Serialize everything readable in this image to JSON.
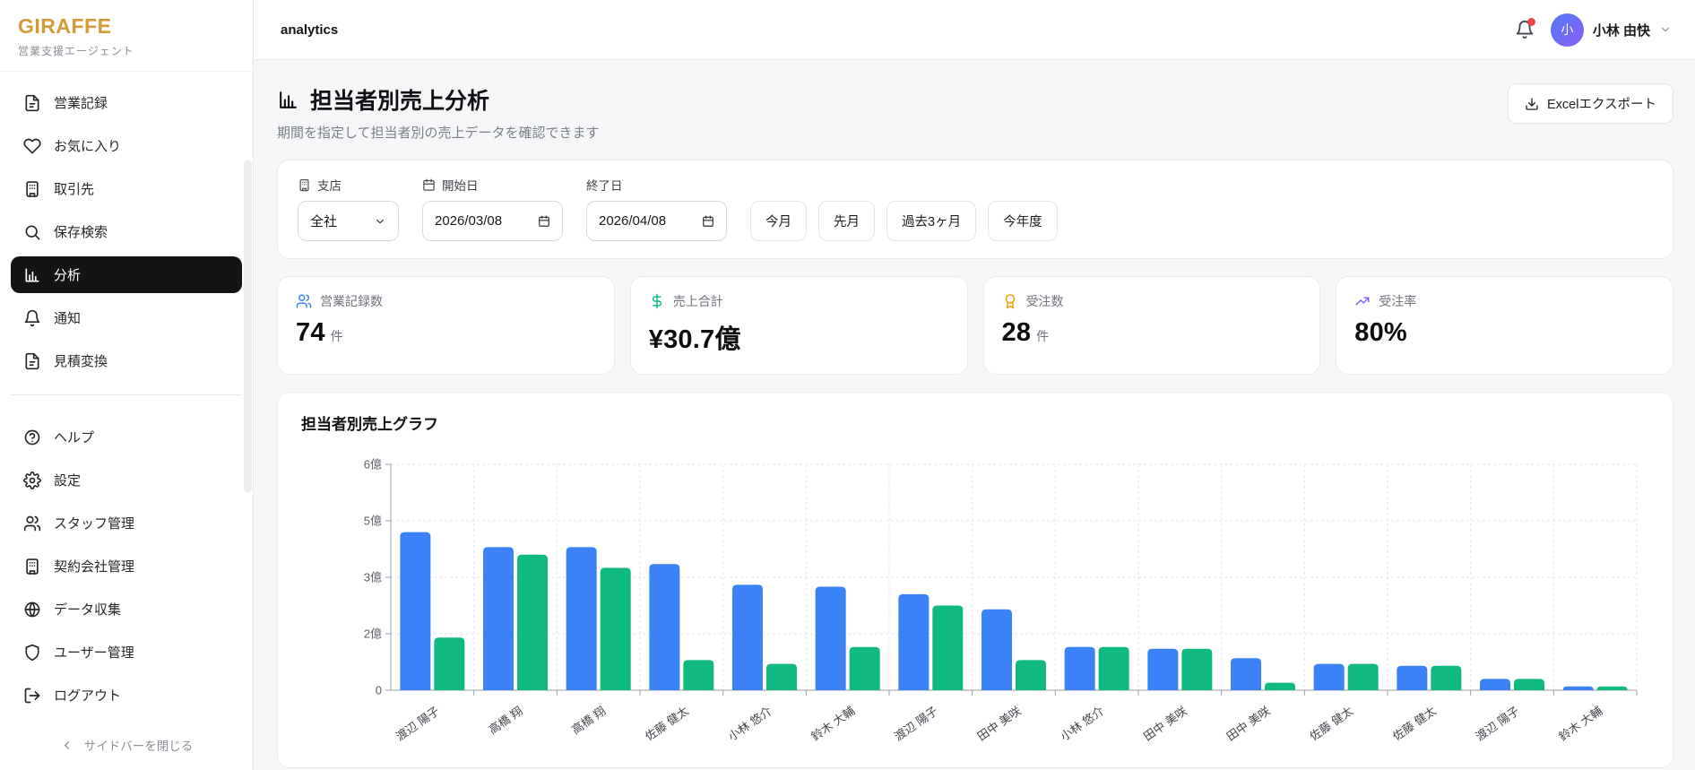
{
  "brand": {
    "name": "GIRAFFE",
    "tagline": "営業支援エージェント",
    "color": "#d49a35"
  },
  "topbar": {
    "title": "analytics",
    "user_name": "小林 由快",
    "avatar_initial": "小",
    "avatar_gradient": [
      "#4f7cf7",
      "#8b5cf6"
    ],
    "notification_dot_color": "#ef4444"
  },
  "sidebar": {
    "main_items": [
      {
        "label": "営業記録",
        "icon": "file-text",
        "active": false
      },
      {
        "label": "お気に入り",
        "icon": "heart",
        "active": false
      },
      {
        "label": "取引先",
        "icon": "building",
        "active": false
      },
      {
        "label": "保存検索",
        "icon": "search",
        "active": false
      },
      {
        "label": "分析",
        "icon": "bar-chart",
        "active": true
      },
      {
        "label": "通知",
        "icon": "bell",
        "active": false
      },
      {
        "label": "見積変換",
        "icon": "file-text",
        "active": false
      }
    ],
    "secondary_items": [
      {
        "label": "ヘルプ",
        "icon": "help-circle",
        "active": false
      },
      {
        "label": "設定",
        "icon": "gear",
        "active": false
      },
      {
        "label": "スタッフ管理",
        "icon": "users",
        "active": false
      },
      {
        "label": "契約会社管理",
        "icon": "building",
        "active": false
      },
      {
        "label": "データ収集",
        "icon": "globe",
        "active": false
      },
      {
        "label": "ユーザー管理",
        "icon": "shield",
        "active": false
      },
      {
        "label": "ログアウト",
        "icon": "log-out",
        "active": false
      }
    ],
    "collapse_label": "サイドバーを閉じる",
    "active_bg": "#141416"
  },
  "header": {
    "title": "担当者別売上分析",
    "subtitle": "期間を指定して担当者別の売上データを確認できます",
    "export_label": "Excelエクスポート"
  },
  "filters": {
    "branch_label": "支店",
    "branch_value": "全社",
    "start_label": "開始日",
    "start_value": "2026/03/08",
    "end_label": "終了日",
    "end_value": "2026/04/08",
    "quick_ranges": [
      "今月",
      "先月",
      "過去3ヶ月",
      "今年度"
    ]
  },
  "stats": [
    {
      "label": "営業記録数",
      "value": "74",
      "unit": "件",
      "icon": "users",
      "color": "#3b82f6"
    },
    {
      "label": "売上合計",
      "value": "¥30.7億",
      "unit": "",
      "icon": "dollar",
      "color": "#10b981"
    },
    {
      "label": "受注数",
      "value": "28",
      "unit": "件",
      "icon": "award",
      "color": "#f59e0b"
    },
    {
      "label": "受注率",
      "value": "80%",
      "unit": "",
      "icon": "trend-up",
      "color": "#8b5cf6"
    }
  ],
  "chart_data": {
    "type": "bar",
    "title": "担当者別売上グラフ",
    "categories": [
      "渡辺 陽子",
      "高橋 翔",
      "高橋 翔",
      "佐藤 健太",
      "小林 悠介",
      "鈴木 大輔",
      "渡辺 陽子",
      "田中 美咲",
      "小林 悠介",
      "田中 美咲",
      "田中 美咲",
      "佐藤 健太",
      "佐藤 健太",
      "渡辺 陽子",
      "鈴木 大輔"
    ],
    "series": [
      {
        "color": "#3b82f6",
        "values": [
          4.2,
          3.8,
          3.8,
          3.35,
          2.8,
          2.75,
          2.55,
          2.15,
          1.15,
          1.1,
          0.85,
          0.7,
          0.65,
          0.3,
          0.1
        ]
      },
      {
        "color": "#10b981",
        "values": [
          1.4,
          3.6,
          3.25,
          0.8,
          0.7,
          1.15,
          2.25,
          0.8,
          1.15,
          1.1,
          0.2,
          0.7,
          0.65,
          0.3,
          0.1
        ]
      }
    ],
    "value_unit": "億",
    "ylim": [
      0,
      6
    ],
    "y_tick_labels_top_to_bottom": [
      "6億",
      "5億",
      "3億",
      "2億",
      "0"
    ],
    "grid": true,
    "legend": false,
    "x_labels_rotated": true
  }
}
